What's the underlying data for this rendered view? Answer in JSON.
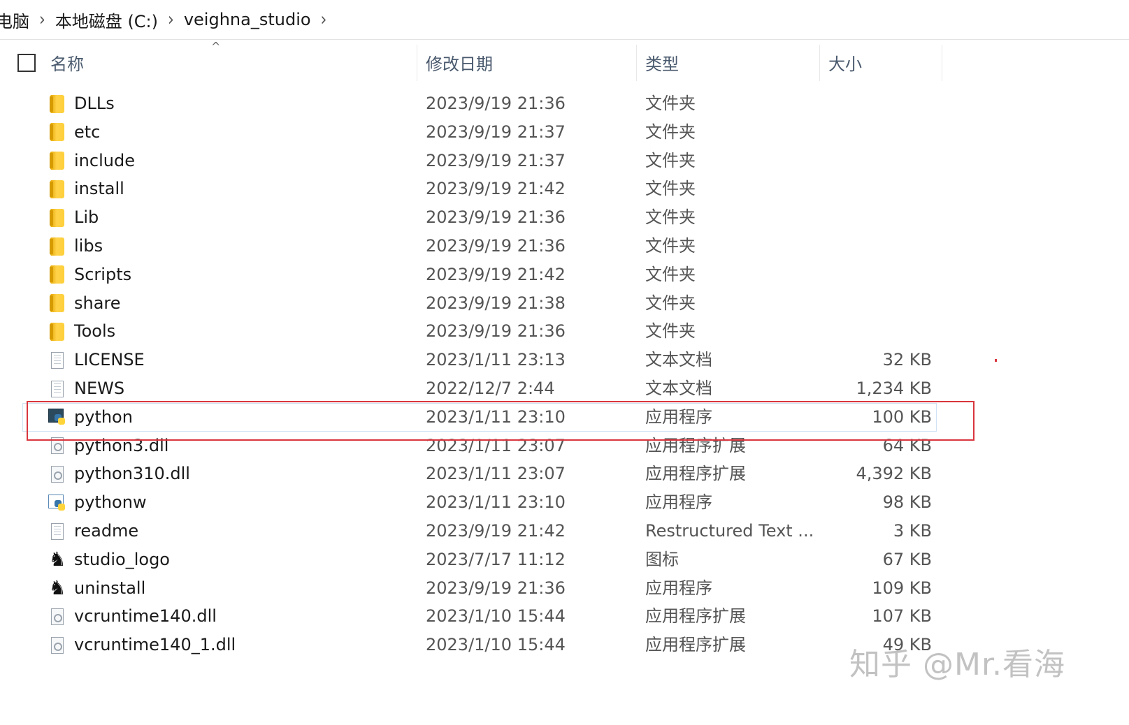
{
  "breadcrumb": {
    "items": [
      "电脑",
      "本地磁盘 (C:)",
      "veighna_studio"
    ],
    "separator": "›"
  },
  "header": {
    "name": "名称",
    "date": "修改日期",
    "type": "类型",
    "size": "大小",
    "sort_indicator": "^"
  },
  "files": [
    {
      "name": "DLLs",
      "date": "2023/9/19 21:36",
      "type": "文件夹",
      "size": "",
      "icon": "folder-icon"
    },
    {
      "name": "etc",
      "date": "2023/9/19 21:37",
      "type": "文件夹",
      "size": "",
      "icon": "folder-icon"
    },
    {
      "name": "include",
      "date": "2023/9/19 21:37",
      "type": "文件夹",
      "size": "",
      "icon": "folder-icon"
    },
    {
      "name": "install",
      "date": "2023/9/19 21:42",
      "type": "文件夹",
      "size": "",
      "icon": "folder-icon"
    },
    {
      "name": "Lib",
      "date": "2023/9/19 21:36",
      "type": "文件夹",
      "size": "",
      "icon": "folder-icon"
    },
    {
      "name": "libs",
      "date": "2023/9/19 21:36",
      "type": "文件夹",
      "size": "",
      "icon": "folder-icon"
    },
    {
      "name": "Scripts",
      "date": "2023/9/19 21:42",
      "type": "文件夹",
      "size": "",
      "icon": "folder-icon"
    },
    {
      "name": "share",
      "date": "2023/9/19 21:38",
      "type": "文件夹",
      "size": "",
      "icon": "folder-icon"
    },
    {
      "name": "Tools",
      "date": "2023/9/19 21:36",
      "type": "文件夹",
      "size": "",
      "icon": "folder-icon"
    },
    {
      "name": "LICENSE",
      "date": "2023/1/11 23:13",
      "type": "文本文档",
      "size": "32 KB",
      "icon": "text-document-icon"
    },
    {
      "name": "NEWS",
      "date": "2022/12/7 2:44",
      "type": "文本文档",
      "size": "1,234 KB",
      "icon": "text-document-icon"
    },
    {
      "name": "python",
      "date": "2023/1/11 23:10",
      "type": "应用程序",
      "size": "100 KB",
      "icon": "python-exe-icon",
      "selected": true
    },
    {
      "name": "python3.dll",
      "date": "2023/1/11 23:07",
      "type": "应用程序扩展",
      "size": "64 KB",
      "icon": "dll-icon"
    },
    {
      "name": "python310.dll",
      "date": "2023/1/11 23:07",
      "type": "应用程序扩展",
      "size": "4,392 KB",
      "icon": "dll-icon"
    },
    {
      "name": "pythonw",
      "date": "2023/1/11 23:10",
      "type": "应用程序",
      "size": "98 KB",
      "icon": "pythonw-exe-icon"
    },
    {
      "name": "readme",
      "date": "2023/9/19 21:42",
      "type": "Restructured Text ...",
      "size": "3 KB",
      "icon": "text-document-icon"
    },
    {
      "name": "studio_logo",
      "date": "2023/7/17 11:12",
      "type": "图标",
      "size": "67 KB",
      "icon": "horse-logo-icon"
    },
    {
      "name": "uninstall",
      "date": "2023/9/19 21:36",
      "type": "应用程序",
      "size": "109 KB",
      "icon": "horse-logo-icon"
    },
    {
      "name": "vcruntime140.dll",
      "date": "2023/1/10 15:44",
      "type": "应用程序扩展",
      "size": "107 KB",
      "icon": "dll-icon"
    },
    {
      "name": "vcruntime140_1.dll",
      "date": "2023/1/10 15:44",
      "type": "应用程序扩展",
      "size": "49 KB",
      "icon": "dll-icon"
    }
  ],
  "watermark": "知乎 @Mr.看海",
  "colors": {
    "highlight": "#d9363e",
    "header_text": "#4a5a6e",
    "folder": "#ffcf3a"
  }
}
